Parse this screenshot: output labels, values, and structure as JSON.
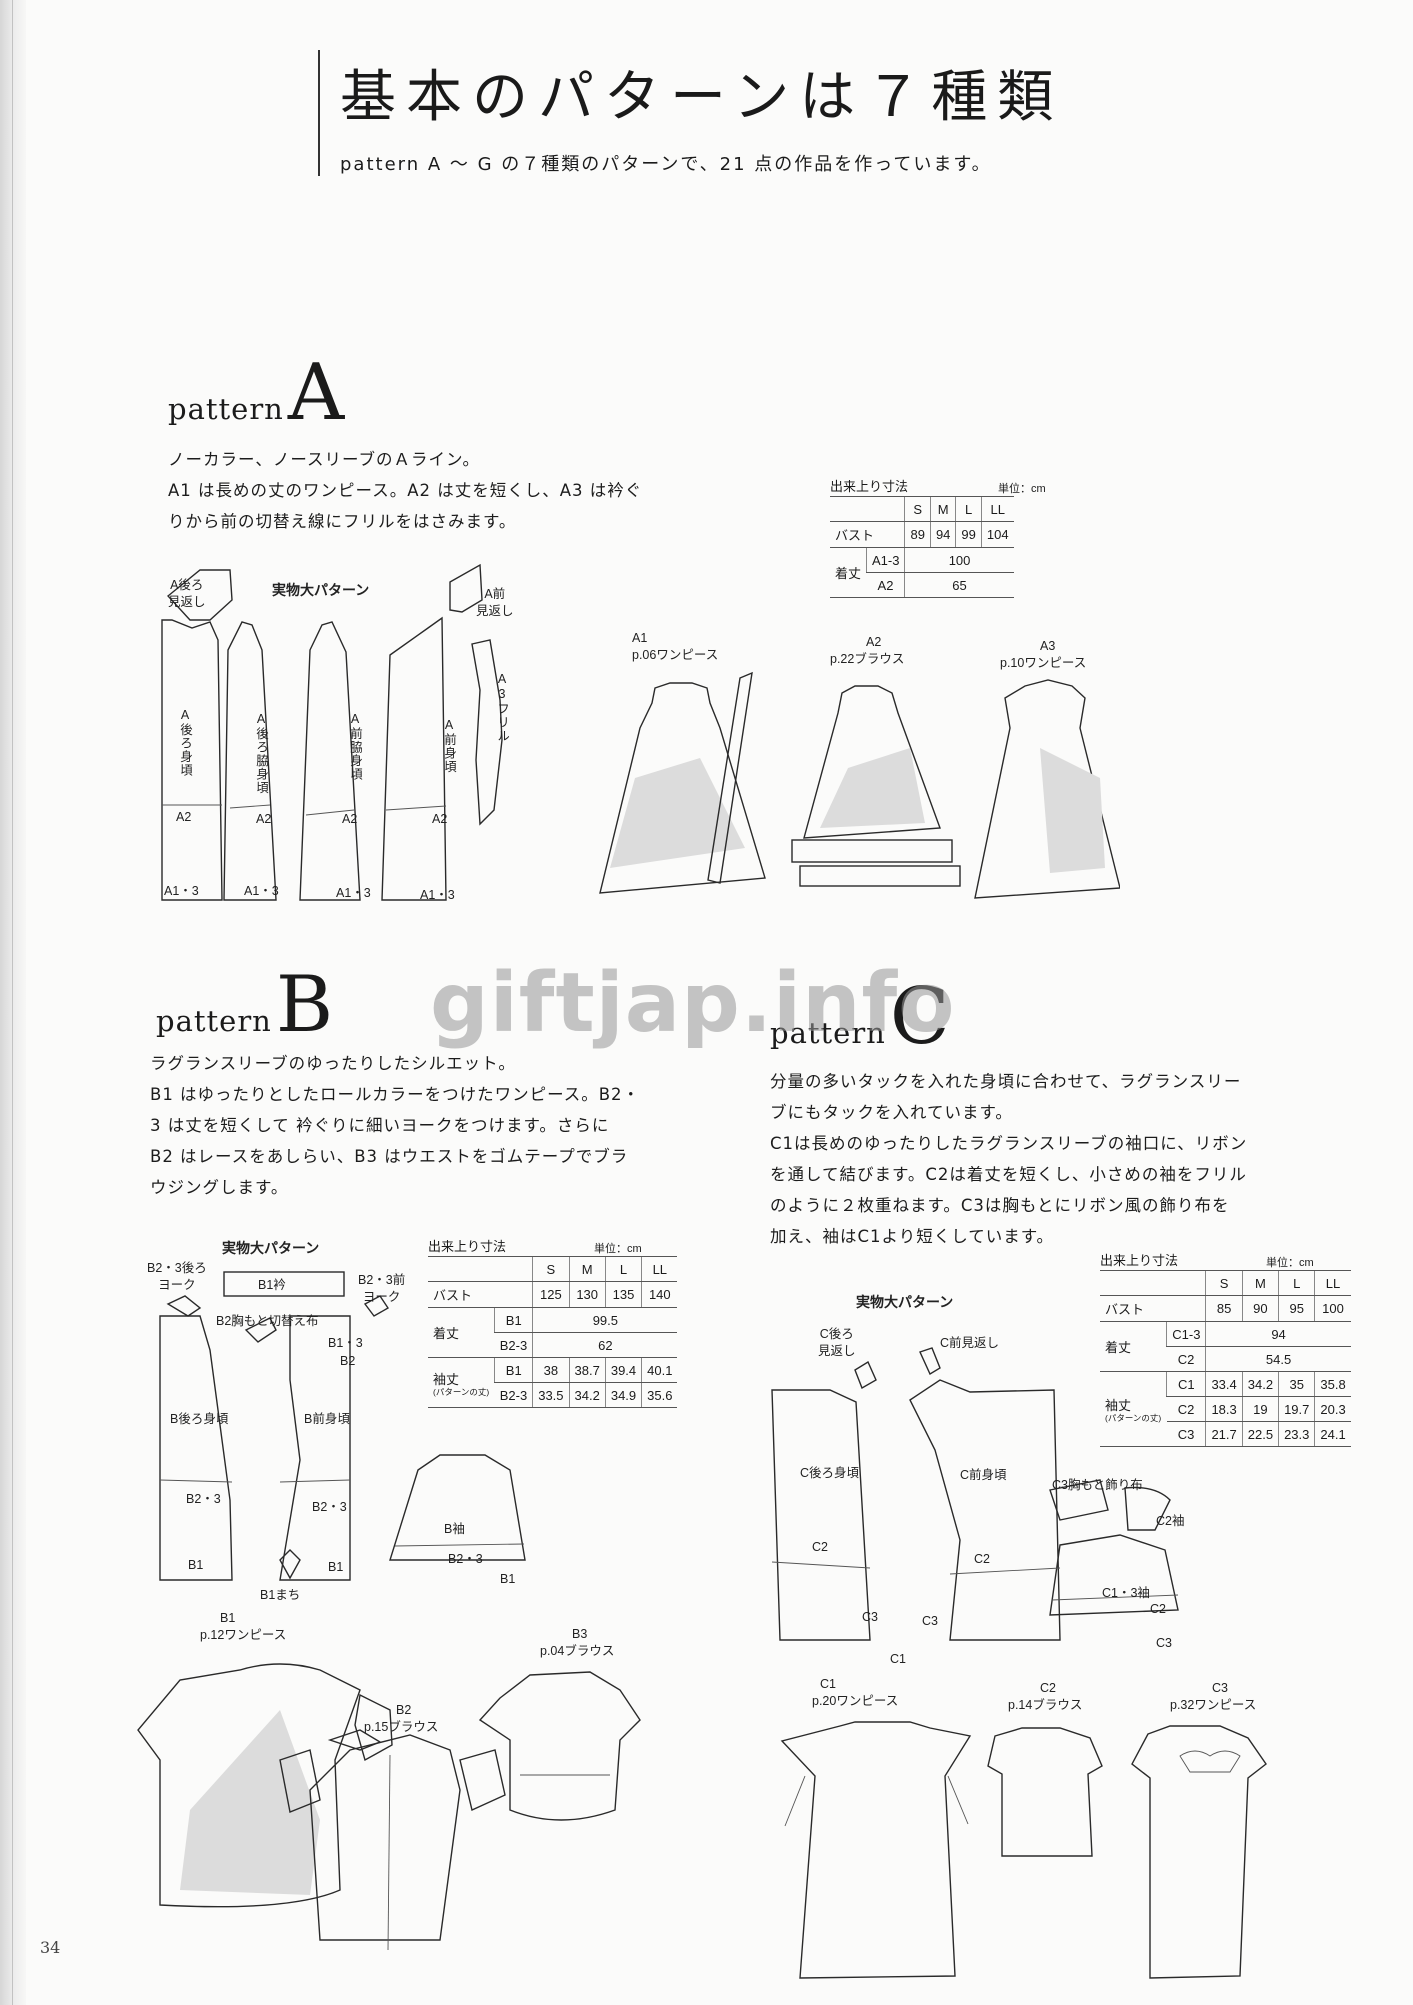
{
  "page": {
    "title": "基本のパターンは７種類",
    "lead": "pattern A 〜 G の７種類のパターンで、21 点の作品を作っています。",
    "page_number": "34",
    "watermark": "giftjap.info"
  },
  "common": {
    "pattern_word": "pattern",
    "full_size_pattern": "実物大パターン",
    "size_table_caption": "出来上り寸法",
    "unit": "単位：cm"
  },
  "pattern_a": {
    "letter": "A",
    "description": [
      "ノーカラー、ノースリーブのＡライン。",
      "A1 は長めの丈のワンピース。A2 は丈を短くし、A3 は衿ぐ",
      "りから前の切替え線にフリルをはさみます。"
    ],
    "size_table": {
      "header": [
        "",
        "",
        "S",
        "M",
        "L",
        "LL"
      ],
      "bust": [
        "バスト",
        "89",
        "94",
        "99",
        "104"
      ],
      "length_label": "着丈",
      "length_rows": [
        [
          "A1-3",
          "100"
        ],
        [
          "A2",
          "65"
        ]
      ]
    },
    "pieces": {
      "back_facing": "A後ろ\n見返し",
      "front_facing": "A前\n見返し",
      "back": "A後ろ身頃",
      "back_side": "A後ろ脇身頃",
      "front_side": "A前脇身頃",
      "front": "A前身頃",
      "frill": "A3フリル",
      "a2": "A2",
      "a13": "A1・3"
    },
    "garments": [
      {
        "code": "A1",
        "page": "p.06ワンピース"
      },
      {
        "code": "A2",
        "page": "p.22ブラウス"
      },
      {
        "code": "A3",
        "page": "p.10ワンピース"
      }
    ]
  },
  "pattern_b": {
    "letter": "B",
    "description": [
      "ラグランスリーブのゆったりしたシルエット。",
      "B1 はゆったりとしたロールカラーをつけたワンピース。B2・",
      "3 は丈を短くして 衿ぐりに細いヨークをつけます。さらに",
      "B2 はレースをあしらい、B3 はウエストをゴムテープでブラ",
      "ウジングします。"
    ],
    "size_table": {
      "header": [
        "",
        "",
        "S",
        "M",
        "L",
        "LL"
      ],
      "bust": [
        "バスト",
        "125",
        "130",
        "135",
        "140"
      ],
      "length_label": "着丈",
      "length_rows": [
        [
          "B1",
          "99.5"
        ],
        [
          "B2-3",
          "62"
        ]
      ],
      "sleeve_label": "袖丈",
      "sleeve_note": "(パターンの丈)",
      "sleeve_rows": [
        [
          "B1",
          "38",
          "38.7",
          "39.4",
          "40.1"
        ],
        [
          "B2-3",
          "33.5",
          "34.2",
          "34.9",
          "35.6"
        ]
      ]
    },
    "pieces": {
      "back_yoke": "B2・3後ろ\nヨーク",
      "collar": "B1衿",
      "front_yoke": "B2・3前\nヨーク",
      "chest_panel": "B2胸もと切替え布",
      "back": "B後ろ身頃",
      "front": "B前身頃",
      "sleeve": "B袖",
      "gusset": "B1まち",
      "b13": "B1・3",
      "b2": "B2",
      "b23": "B2・3",
      "b1": "B1"
    },
    "garments": [
      {
        "code": "B1",
        "page": "p.12ワンピース"
      },
      {
        "code": "B2",
        "page": "p.15ブラウス"
      },
      {
        "code": "B3",
        "page": "p.04ブラウス"
      }
    ]
  },
  "pattern_c": {
    "letter": "C",
    "description": [
      "分量の多いタックを入れた身頃に合わせて、ラグランスリー",
      "ブにもタックを入れています。",
      "C1は長めのゆったりしたラグランスリーブの袖口に、リボン",
      "を通して結びます。C2は着丈を短くし、小さめの袖をフリル",
      "のように２枚重ねます。C3は胸もとにリボン風の飾り布を",
      "加え、袖はC1より短くしています。"
    ],
    "size_table": {
      "header": [
        "",
        "",
        "S",
        "M",
        "L",
        "LL"
      ],
      "bust": [
        "バスト",
        "85",
        "90",
        "95",
        "100"
      ],
      "length_label": "着丈",
      "length_rows": [
        [
          "C1-3",
          "94"
        ],
        [
          "C2",
          "54.5"
        ]
      ],
      "sleeve_label": "袖丈",
      "sleeve_note": "(パターンの丈)",
      "sleeve_rows": [
        [
          "C1",
          "33.4",
          "34.2",
          "35",
          "35.8"
        ],
        [
          "C2",
          "18.3",
          "19",
          "19.7",
          "20.3"
        ],
        [
          "C3",
          "21.7",
          "22.5",
          "23.3",
          "24.1"
        ]
      ]
    },
    "pieces": {
      "back_facing": "C後ろ\n見返し",
      "front_facing": "C前見返し",
      "back": "C後ろ身頃",
      "front": "C前身頃",
      "chest_deco": "C3胸もと飾り布",
      "c2_sleeve": "C2袖",
      "c13_sleeve": "C1・3袖",
      "c2": "C2",
      "c3": "C3",
      "c1": "C1"
    },
    "garments": [
      {
        "code": "C1",
        "page": "p.20ワンピース"
      },
      {
        "code": "C2",
        "page": "p.14ブラウス"
      },
      {
        "code": "C3",
        "page": "p.32ワンピース"
      }
    ]
  }
}
